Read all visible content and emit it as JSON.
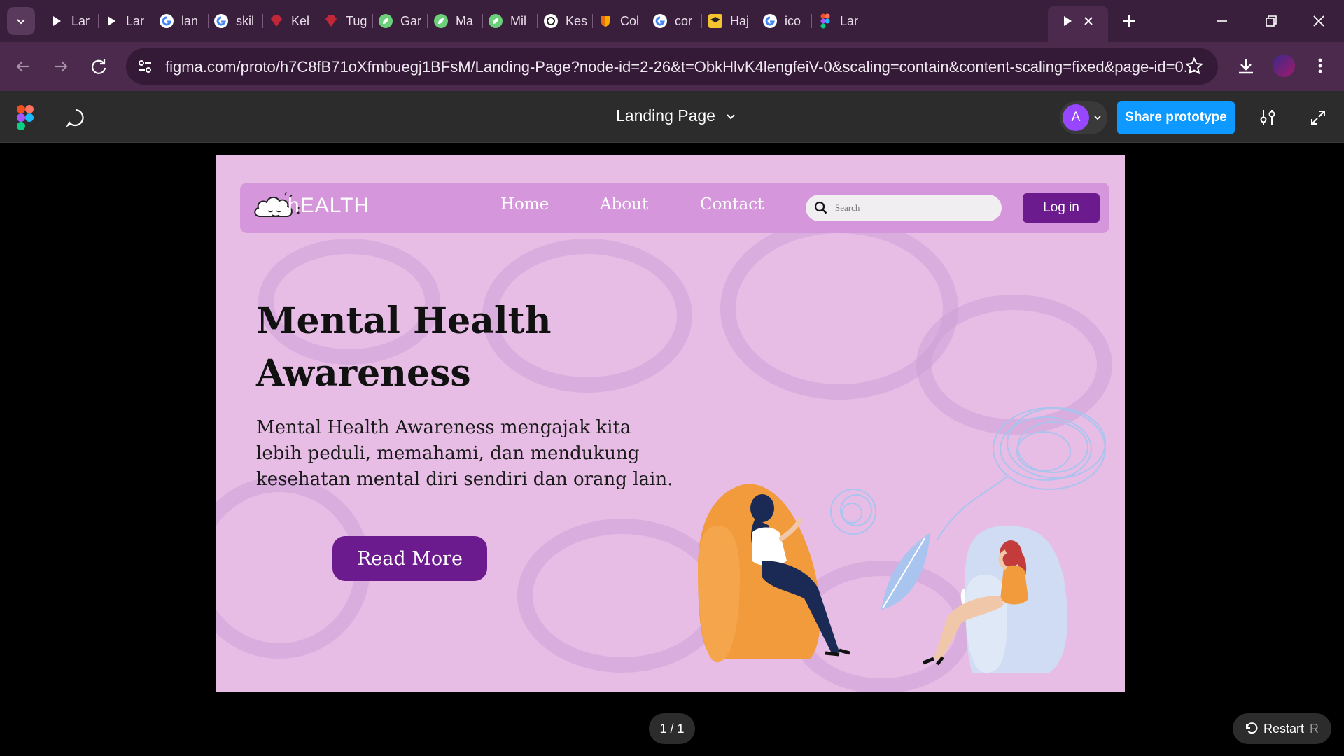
{
  "browser": {
    "tabs": [
      {
        "label": "Lar",
        "icon": "play-icon"
      },
      {
        "label": "Lar",
        "icon": "play-icon"
      },
      {
        "label": "lan",
        "icon": "google-icon"
      },
      {
        "label": "skil",
        "icon": "google-icon"
      },
      {
        "label": "Kel",
        "icon": "gem-icon"
      },
      {
        "label": "Tug",
        "icon": "gem-icon"
      },
      {
        "label": "Gar",
        "icon": "leaf-icon"
      },
      {
        "label": "Ma",
        "icon": "leaf-icon"
      },
      {
        "label": "Mil",
        "icon": "leaf-icon"
      },
      {
        "label": "Kes",
        "icon": "openai-icon"
      },
      {
        "label": "Col",
        "icon": "colab-icon"
      },
      {
        "label": "cor",
        "icon": "google-icon"
      },
      {
        "label": "Haj",
        "icon": "layers-icon"
      },
      {
        "label": "ico",
        "icon": "google-icon"
      },
      {
        "label": "Lar",
        "icon": "figma-icon"
      }
    ],
    "url": "figma.com/proto/h7C8fB71oXfmbuegj1BFsM/Landing-Page?node-id=2-26&t=ObkHlvK4lengfeiV-0&scaling=contain&content-scaling=fixed&page-id=0..."
  },
  "figma": {
    "title": "Landing Page",
    "avatar_letter": "A",
    "share_label": "Share prototype",
    "pager": "1 / 1",
    "restart_label": "Restart",
    "restart_key": "R"
  },
  "site": {
    "brand": "hEALTH",
    "nav": [
      "Home",
      "About",
      "Contact"
    ],
    "search_placeholder": "Search",
    "login_label": "Log in",
    "hero_title": "Mental Health Awareness",
    "hero_desc": "Mental Health Awareness mengajak kita lebih peduli, memahami, dan mendukung kesehatan mental diri sendiri dan orang lain.",
    "cta_label": "Read More"
  },
  "colors": {
    "page_bg": "#e7bde6",
    "nav_bg": "#d596dc",
    "accent": "#6c1b8e",
    "figma_blue": "#0d99ff"
  }
}
